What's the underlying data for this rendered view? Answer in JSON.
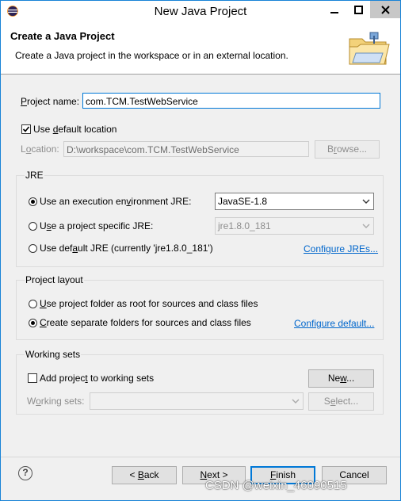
{
  "window": {
    "title": "New Java Project",
    "minimize_icon": "minimize-icon",
    "maximize_icon": "maximize-icon",
    "close_icon": "close-icon"
  },
  "header": {
    "title": "Create a Java Project",
    "description": "Create a Java project in the workspace or in an external location.",
    "image_icon": "folder-wizard-icon"
  },
  "project_name": {
    "label_pre": "",
    "label_u": "P",
    "label_post": "roject name:",
    "value": "com.TCM.TestWebService"
  },
  "location": {
    "use_default_pre": "Use ",
    "use_default_u": "d",
    "use_default_post": "efault location",
    "use_default_checked": true,
    "label_pre": "L",
    "label_u": "o",
    "label_post": "cation:",
    "value": "D:\\workspace\\com.TCM.TestWebService",
    "browse_pre": "B",
    "browse_u": "r",
    "browse_post": "owse..."
  },
  "jre": {
    "group_title": "JRE",
    "option1_pre": "Use an execution en",
    "option1_u": "v",
    "option1_post": "ironment JRE:",
    "option1_selected": true,
    "option1_value": "JavaSE-1.8",
    "option2_pre": "U",
    "option2_u": "s",
    "option2_post": "e a project specific JRE:",
    "option2_selected": false,
    "option2_value": "jre1.8.0_181",
    "option3_pre": "Use def",
    "option3_u": "a",
    "option3_post": "ult JRE (currently 'jre1.8.0_181')",
    "option3_selected": false,
    "configure_pre": "Configure J",
    "configure_u": "",
    "configure_post": "REs..."
  },
  "project_layout": {
    "group_title": "Project layout",
    "option1_pre": "",
    "option1_u": "U",
    "option1_post": "se project folder as root for sources and class files",
    "option1_selected": false,
    "option2_pre": "",
    "option2_u": "C",
    "option2_post": "reate separate folders for sources and class files",
    "option2_selected": true,
    "configure": "Configure default..."
  },
  "working_sets": {
    "group_title": "Working sets",
    "add_pre": "Add projec",
    "add_u": "t",
    "add_post": " to working sets",
    "add_checked": false,
    "new_pre": "Ne",
    "new_u": "w",
    "new_post": "...",
    "label_pre": "W",
    "label_u": "o",
    "label_post": "rking sets:",
    "value": "",
    "select_pre": "S",
    "select_u": "e",
    "select_post": "lect..."
  },
  "footer": {
    "help_icon": "help-icon",
    "help_glyph": "?",
    "back_pre": "< ",
    "back_u": "B",
    "back_post": "ack",
    "next_pre": "",
    "next_u": "N",
    "next_post": "ext >",
    "finish_pre": "",
    "finish_u": "F",
    "finish_post": "inish",
    "cancel": "Cancel"
  },
  "watermark": "CSDN @weixin_46090515",
  "colors": {
    "accent": "#0078d7",
    "link": "#0066cc",
    "window_border": "#1883d7"
  }
}
